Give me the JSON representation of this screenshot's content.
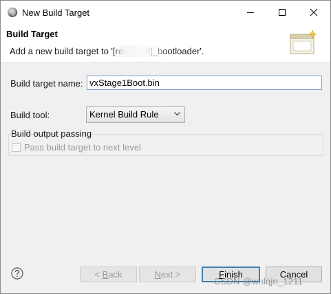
{
  "window": {
    "title": "New Build Target",
    "icon": "eclipse-sphere-icon"
  },
  "banner": {
    "title": "Build Target",
    "description": "Add a new build target to '[redacted]_bootloader'.",
    "icon": "new-wizard-window-icon"
  },
  "form": {
    "target_name_label": "Build target name:",
    "target_name_value": "vxStage1Boot.bin",
    "build_tool_label": "Build tool:",
    "build_tool_value": "Kernel Build Rule",
    "output_group_label": "Build output passing",
    "pass_target_label": "Pass build target to next level",
    "pass_target_checked": false,
    "pass_target_enabled": false
  },
  "footer": {
    "help_icon": "help-question-icon",
    "back": {
      "mnemonic": "B",
      "rest": "ack",
      "prefix": "< ",
      "enabled": false
    },
    "next": {
      "mnemonic": "N",
      "rest": "ext",
      "suffix": " >",
      "enabled": false
    },
    "finish": {
      "mnemonic": "F",
      "rest": "inish",
      "enabled": true,
      "default": true
    },
    "cancel": {
      "label": "Cancel",
      "enabled": true
    }
  },
  "watermark": "CSDN @whlqjn_1211",
  "colors": {
    "focus_border": "#7a9cd3",
    "default_button_border": "#3c7fb1",
    "body_bg": "#f0f0f0"
  }
}
